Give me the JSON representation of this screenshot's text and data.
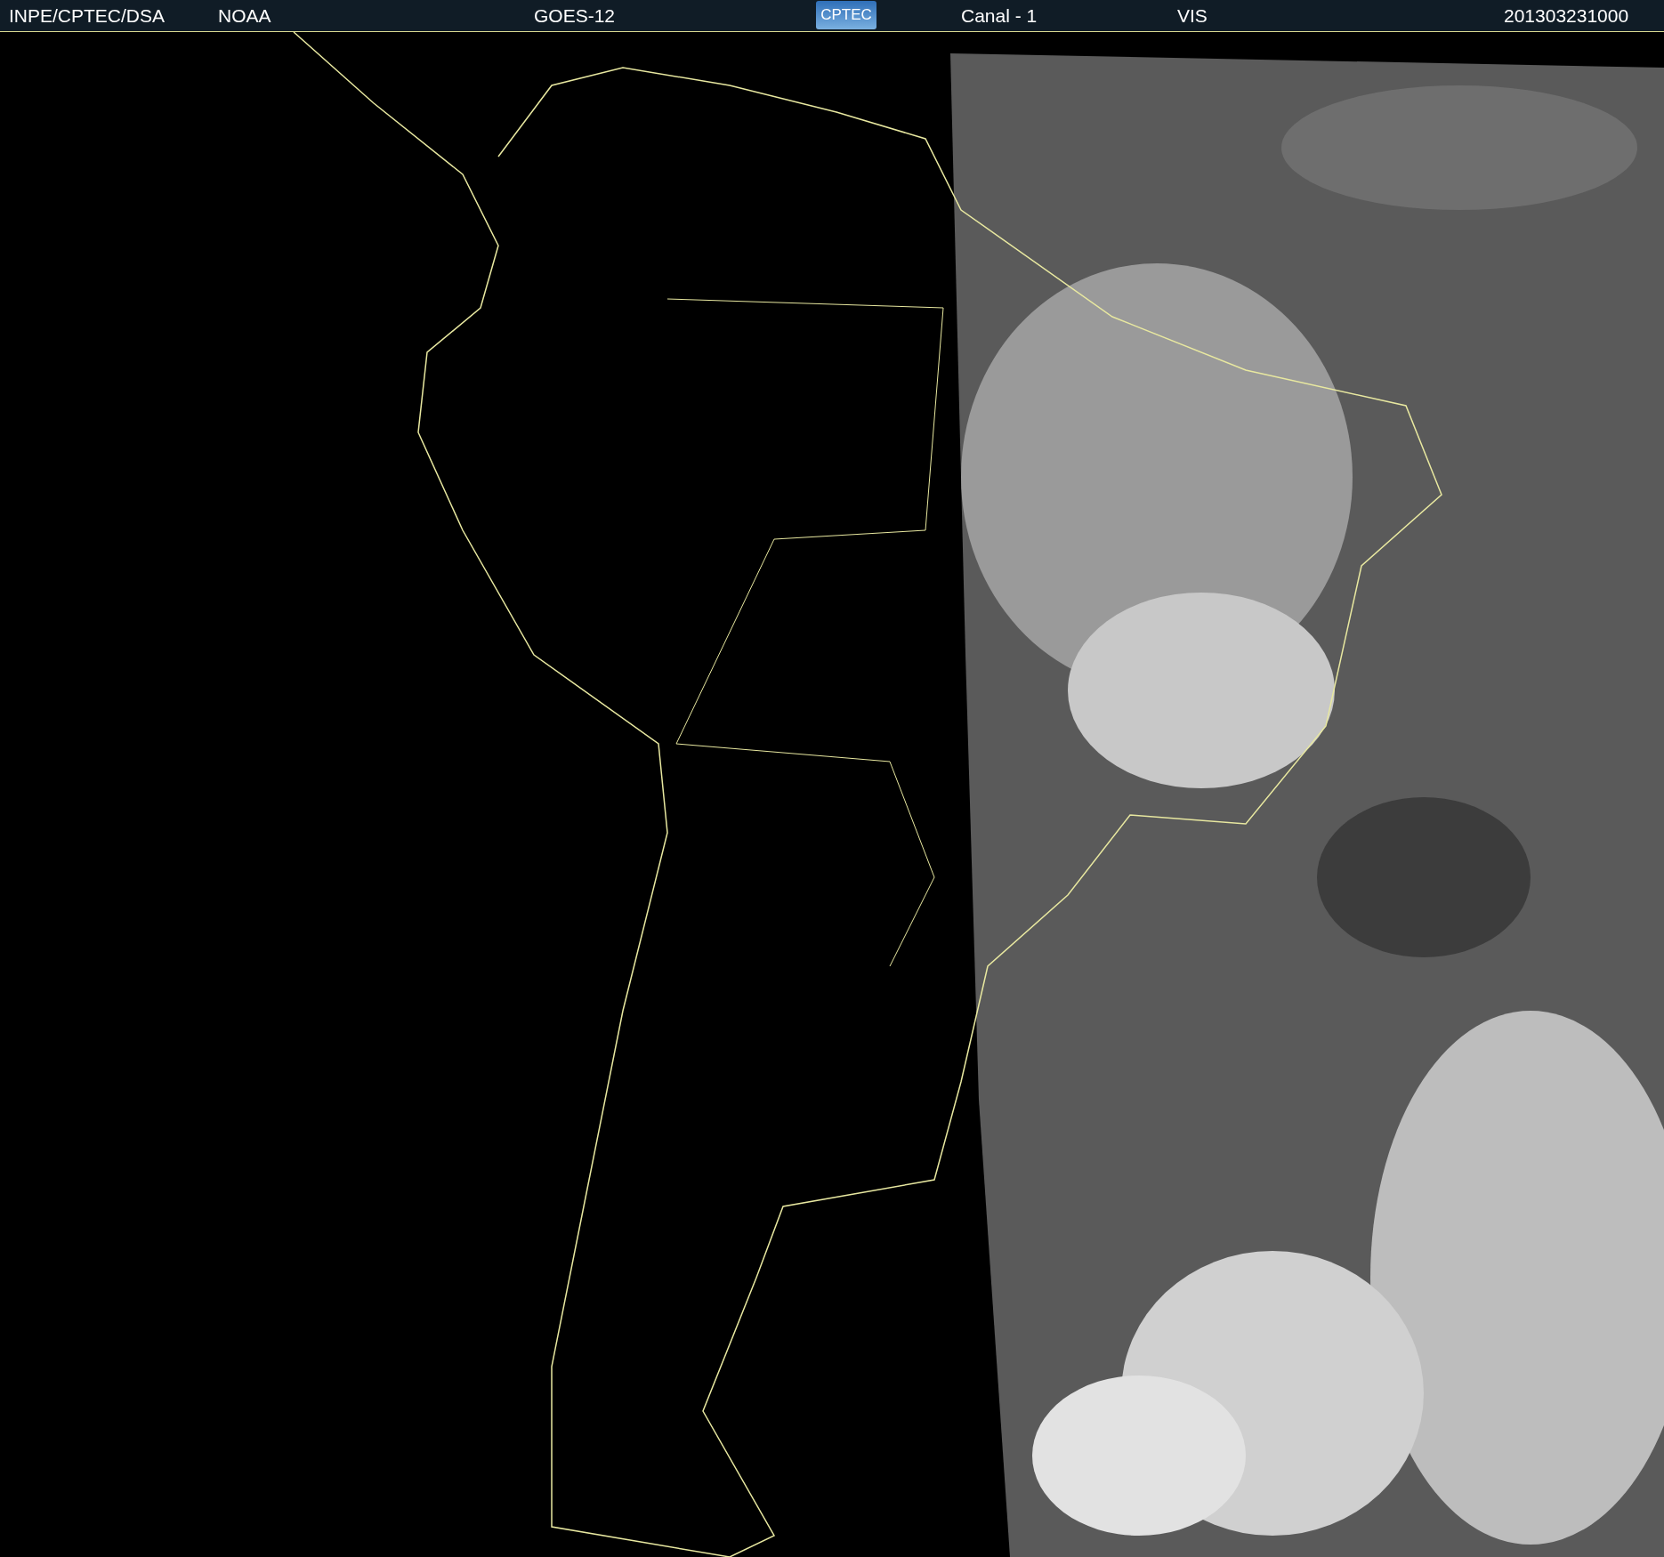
{
  "header": {
    "items": [
      {
        "kind": "text",
        "text": "INPE/CPTEC/DSA"
      },
      {
        "kind": "text",
        "text": "NOAA"
      },
      {
        "kind": "text",
        "text": "GOES-12"
      },
      {
        "kind": "logo",
        "text": "CPTEC"
      },
      {
        "kind": "text",
        "text": "Canal - 1"
      },
      {
        "kind": "text",
        "text": "VIS"
      },
      {
        "kind": "text",
        "text": "201303231000"
      }
    ]
  }
}
